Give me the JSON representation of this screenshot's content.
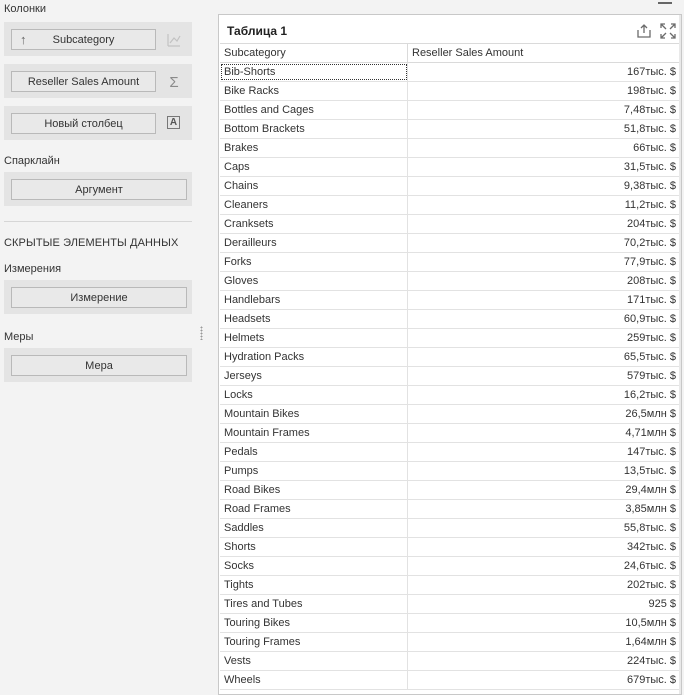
{
  "sections": {
    "columns": "Колонки",
    "sparkline": "Спарклайн",
    "hidden": "СКРЫТЫЕ ЭЛЕМЕНТЫ ДАННЫХ",
    "dimensions": "Измерения",
    "measures": "Меры"
  },
  "columns": {
    "subcategory": "Subcategory",
    "sales": "Reseller Sales Amount",
    "new_column": "Новый столбец"
  },
  "placeholders": {
    "argument": "Аргумент",
    "dimension": "Измерение",
    "measure": "Мера"
  },
  "icons": {
    "arrow": "↑",
    "sum": "Σ",
    "a": "A"
  },
  "panel": {
    "title": "Таблица 1"
  },
  "table": {
    "headers": [
      "Subcategory",
      "Reseller Sales Amount"
    ],
    "rows": [
      [
        "Bib-Shorts",
        "167тыс. $"
      ],
      [
        "Bike Racks",
        "198тыс. $"
      ],
      [
        "Bottles and Cages",
        "7,48тыс. $"
      ],
      [
        "Bottom Brackets",
        "51,8тыс. $"
      ],
      [
        "Brakes",
        "66тыс. $"
      ],
      [
        "Caps",
        "31,5тыс. $"
      ],
      [
        "Chains",
        "9,38тыс. $"
      ],
      [
        "Cleaners",
        "11,2тыс. $"
      ],
      [
        "Cranksets",
        "204тыс. $"
      ],
      [
        "Derailleurs",
        "70,2тыс. $"
      ],
      [
        "Forks",
        "77,9тыс. $"
      ],
      [
        "Gloves",
        "208тыс. $"
      ],
      [
        "Handlebars",
        "171тыс. $"
      ],
      [
        "Headsets",
        "60,9тыс. $"
      ],
      [
        "Helmets",
        "259тыс. $"
      ],
      [
        "Hydration Packs",
        "65,5тыс. $"
      ],
      [
        "Jerseys",
        "579тыс. $"
      ],
      [
        "Locks",
        "16,2тыс. $"
      ],
      [
        "Mountain Bikes",
        "26,5млн $"
      ],
      [
        "Mountain Frames",
        "4,71млн $"
      ],
      [
        "Pedals",
        "147тыс. $"
      ],
      [
        "Pumps",
        "13,5тыс. $"
      ],
      [
        "Road Bikes",
        "29,4млн $"
      ],
      [
        "Road Frames",
        "3,85млн $"
      ],
      [
        "Saddles",
        "55,8тыс. $"
      ],
      [
        "Shorts",
        "342тыс. $"
      ],
      [
        "Socks",
        "24,6тыс. $"
      ],
      [
        "Tights",
        "202тыс. $"
      ],
      [
        "Tires and Tubes",
        "925 $"
      ],
      [
        "Touring Bikes",
        "10,5млн $"
      ],
      [
        "Touring Frames",
        "1,64млн $"
      ],
      [
        "Vests",
        "224тыс. $"
      ],
      [
        "Wheels",
        "679тыс. $"
      ]
    ]
  }
}
